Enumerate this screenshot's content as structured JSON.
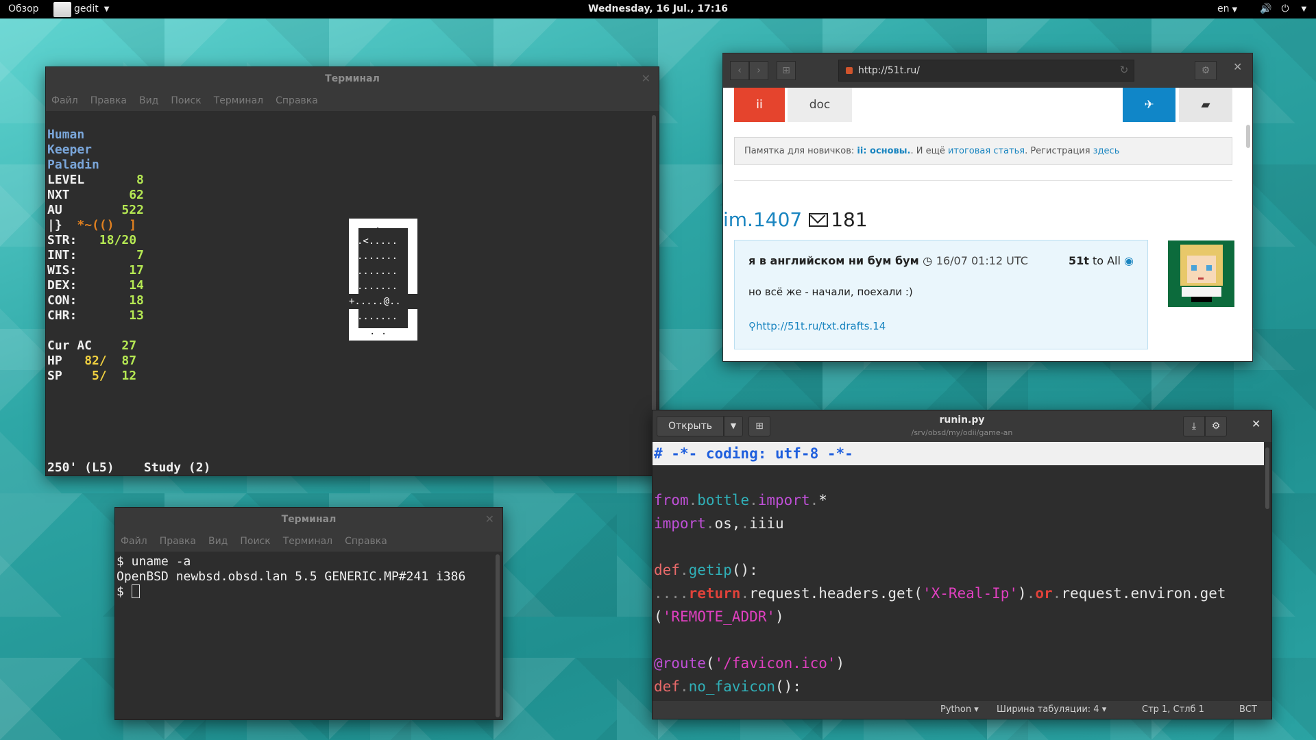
{
  "topbar": {
    "overview": "Обзор",
    "app": "gedit",
    "clock": "Wednesday, 16 Jul., 17:16",
    "lang": "en",
    "volume_icon": "🔊",
    "power_icon": "⏻"
  },
  "terminal1": {
    "title": "Терминал",
    "menu": [
      "Файл",
      "Правка",
      "Вид",
      "Поиск",
      "Терминал",
      "Справка"
    ],
    "race": "Human",
    "role": "Keeper",
    "class": "Paladin",
    "stats": [
      {
        "label": "LEVEL",
        "value": "8"
      },
      {
        "label": "NXT",
        "value": "62"
      },
      {
        "label": "AU",
        "value": "522"
      }
    ],
    "equip_a": "|}",
    "equip_b": "*~(()",
    "equip_c": "]",
    "attrs": [
      {
        "label": "STR:",
        "value": "18/20"
      },
      {
        "label": "INT:",
        "value": "7"
      },
      {
        "label": "WIS:",
        "value": "17"
      },
      {
        "label": "DEX:",
        "value": "14"
      },
      {
        "label": "CON:",
        "value": "18"
      },
      {
        "label": "CHR:",
        "value": "13"
      }
    ],
    "cur_ac_label": "Cur AC",
    "cur_ac": "27",
    "hp_label": "HP",
    "hp_cur": "82/",
    "hp_max": "87",
    "sp_label": "SP",
    "sp_cur": "5/",
    "sp_max": "12",
    "map_rows": [
      ".",
      ".<.....",
      ".......",
      ".......",
      ".......",
      "+.....@..",
      ".......",
      ". ."
    ],
    "status": "250' (L5)    Study (2)"
  },
  "terminal2": {
    "title": "Терминал",
    "menu": [
      "Файл",
      "Правка",
      "Вид",
      "Поиск",
      "Терминал",
      "Справка"
    ],
    "line1": "$ uname -a",
    "line2": "OpenBSD newbsd.obsd.lan 5.5 GENERIC.MP#241 i386",
    "prompt": "$ "
  },
  "browser": {
    "url": "http://51t.ru/",
    "tab_ii": "ii",
    "tab_doc": "doc",
    "notice_prefix": "Памятка для новичков: ",
    "notice_ii": "ii: основы.",
    "notice_mid": ". И ещё ",
    "notice_link2": "итоговая статья",
    "notice_mid2": ". Регистрация ",
    "notice_link3": "здесь",
    "thread": "im.1407",
    "thread_count": "181",
    "post_title": "я в английском ни бум бум",
    "post_date": "16/07 01:12 UTC",
    "post_author": "51t",
    "post_to": "to All",
    "post_body": "но всё же - начали, поехали :)",
    "post_link": "http://51t.ru/txt.drafts.14"
  },
  "gedit": {
    "open": "Открыть",
    "title": "runin.py",
    "path": "/srv/obsd/my/odii/game-an",
    "language": "Python",
    "tab_width": "Ширина табуляции: 4",
    "position": "Стр 1, Стлб 1",
    "mode": "ВСТ"
  }
}
